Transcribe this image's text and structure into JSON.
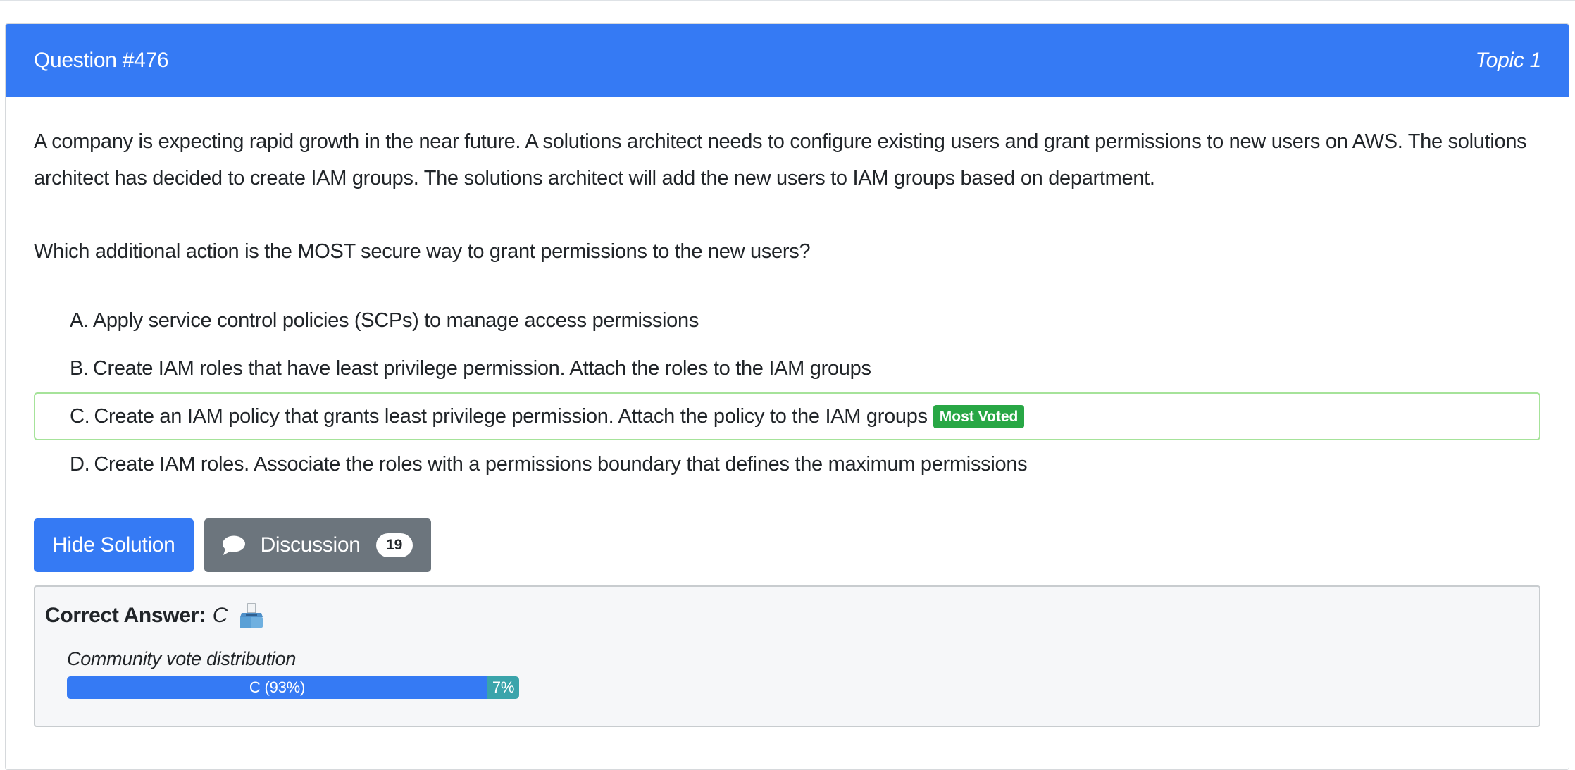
{
  "header": {
    "question_number": "Question #476",
    "topic": "Topic 1"
  },
  "question": {
    "paragraphs": [
      "A company is expecting rapid growth in the near future. A solutions architect needs to configure existing users and grant permissions to new users on AWS. The solutions architect has decided to create IAM groups. The solutions architect will add the new users to IAM groups based on department.",
      "Which additional action is the MOST secure way to grant permissions to the new users?"
    ]
  },
  "choices": [
    {
      "letter": "A.",
      "text": "Apply service control policies (SCPs) to manage access permissions"
    },
    {
      "letter": "B.",
      "text": "Create IAM roles that have least privilege permission. Attach the roles to the IAM groups"
    },
    {
      "letter": "C.",
      "text": "Create an IAM policy that grants least privilege permission. Attach the policy to the IAM groups",
      "badge": "Most Voted"
    },
    {
      "letter": "D.",
      "text": "Create IAM roles. Associate the roles with a permissions boundary that defines the maximum permissions"
    }
  ],
  "buttons": {
    "hide_solution": "Hide Solution",
    "discussion": "Discussion",
    "discussion_count": "19"
  },
  "answer": {
    "label": "Correct Answer:",
    "value": "C",
    "icon": "ballot-box-icon",
    "distribution_caption": "Community vote distribution",
    "distribution": [
      {
        "label": "C (93%)",
        "fraction": 0.93
      },
      {
        "label": "7%",
        "fraction": 0.07
      }
    ]
  },
  "colors": {
    "primary": "#357af4",
    "secondary": "#6c757d",
    "success": "#28a745",
    "voted_border": "#a6e39a",
    "vote_other": "#3aa4ab"
  }
}
